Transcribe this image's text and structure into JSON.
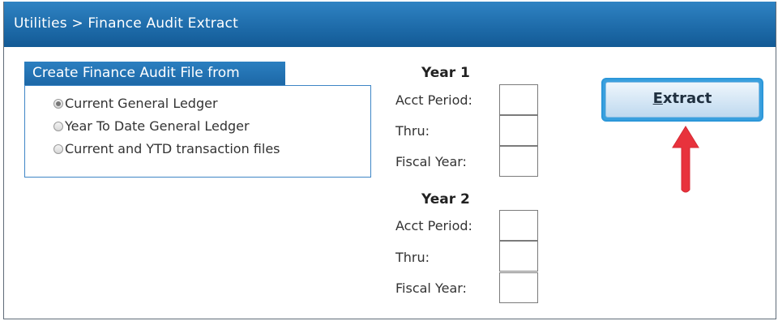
{
  "window": {
    "title": "Utilities > Finance Audit Extract"
  },
  "source_group": {
    "header": "Create Finance Audit File from",
    "options": [
      {
        "label": "Current General Ledger",
        "selected": true
      },
      {
        "label": "Year To Date General Ledger",
        "selected": false
      },
      {
        "label": "Current and YTD transaction files",
        "selected": false
      }
    ]
  },
  "year1": {
    "title": "Year 1",
    "fields": [
      {
        "label": "Acct Period:",
        "value": ""
      },
      {
        "label": "Thru:",
        "value": ""
      },
      {
        "label": "Fiscal Year:",
        "value": ""
      }
    ]
  },
  "year2": {
    "title": "Year 2",
    "fields": [
      {
        "label": "Acct Period:",
        "value": ""
      },
      {
        "label": "Thru:",
        "value": ""
      },
      {
        "label": "Fiscal Year:",
        "value": ""
      }
    ]
  },
  "extract_button": {
    "label_accesskey": "E",
    "label_rest": "xtract"
  },
  "annotation": {
    "arrow_color": "#e8323c",
    "points_to": "extract-button"
  }
}
